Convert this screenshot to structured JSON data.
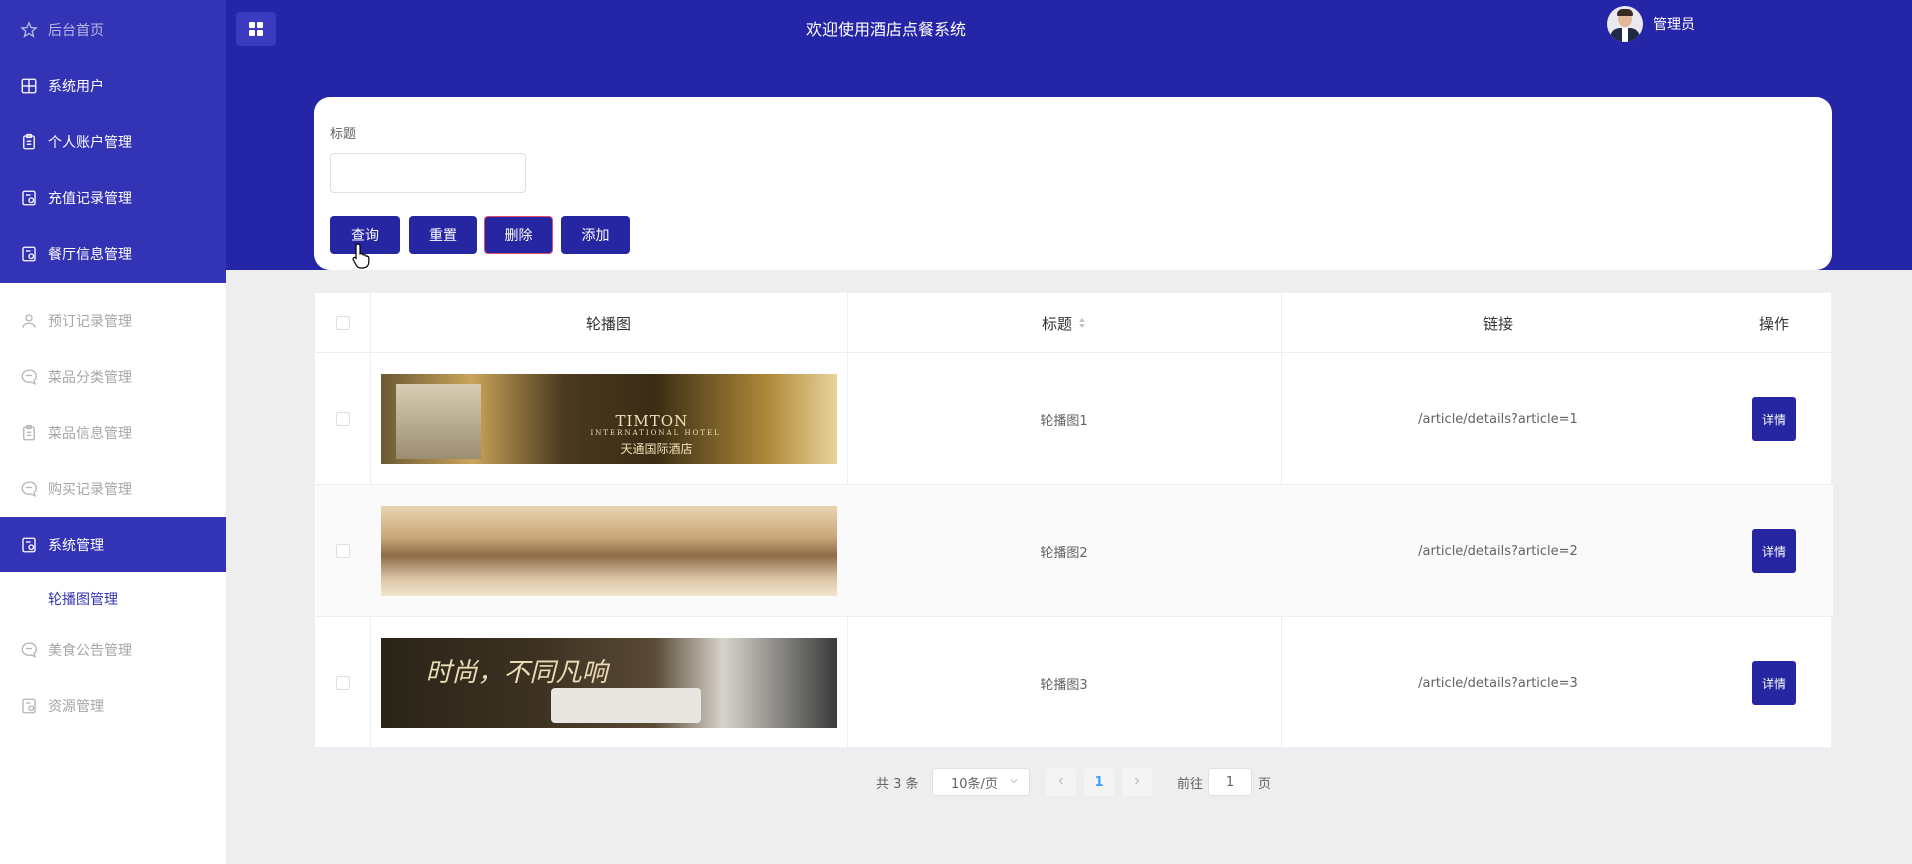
{
  "header": {
    "app_title": "欢迎使用酒店点餐系统",
    "user_name": "管理员"
  },
  "sidebar": {
    "items": [
      {
        "label": "后台首页",
        "icon": "star-icon"
      },
      {
        "label": "系统用户",
        "icon": "grid-icon"
      },
      {
        "label": "个人账户管理",
        "icon": "clipboard-icon"
      },
      {
        "label": "充值记录管理",
        "icon": "document-icon"
      },
      {
        "label": "餐厅信息管理",
        "icon": "document-icon"
      },
      {
        "label": "预订记录管理",
        "icon": "user-icon"
      },
      {
        "label": "菜品分类管理",
        "icon": "chat-icon"
      },
      {
        "label": "菜品信息管理",
        "icon": "clipboard-icon"
      },
      {
        "label": "购买记录管理",
        "icon": "chat-icon"
      },
      {
        "label": "系统管理",
        "icon": "document-icon"
      },
      {
        "label": "美食公告管理",
        "icon": "chat-icon"
      },
      {
        "label": "资源管理",
        "icon": "document-icon"
      }
    ],
    "sub_item": "轮播图管理"
  },
  "search": {
    "title_label": "标题",
    "title_value": "",
    "query_label": "查询",
    "reset_label": "重置",
    "delete_label": "删除",
    "add_label": "添加"
  },
  "table": {
    "headers": [
      "轮播图",
      "标题",
      "链接",
      "操作"
    ],
    "rows": [
      {
        "title": "轮播图1",
        "link": "/article/details?article=1",
        "action": "详情",
        "banner_text": "TIMTON",
        "banner_sub": "INTERNATIONAL HOTEL",
        "banner_cn": "天通国际酒店"
      },
      {
        "title": "轮播图2",
        "link": "/article/details?article=2",
        "action": "详情"
      },
      {
        "title": "轮播图3",
        "link": "/article/details?article=3",
        "action": "详情",
        "banner_text": "时尚，不同凡响"
      }
    ]
  },
  "pagination": {
    "total": "共 3 条",
    "page_size": "10条/页",
    "current_page": "1",
    "goto_prefix": "前往",
    "goto_value": "1",
    "goto_suffix": "页"
  },
  "colors": {
    "primary": "#2626a3",
    "header_bg": "#2525a8",
    "sidebar_blue": "#3333b5"
  }
}
